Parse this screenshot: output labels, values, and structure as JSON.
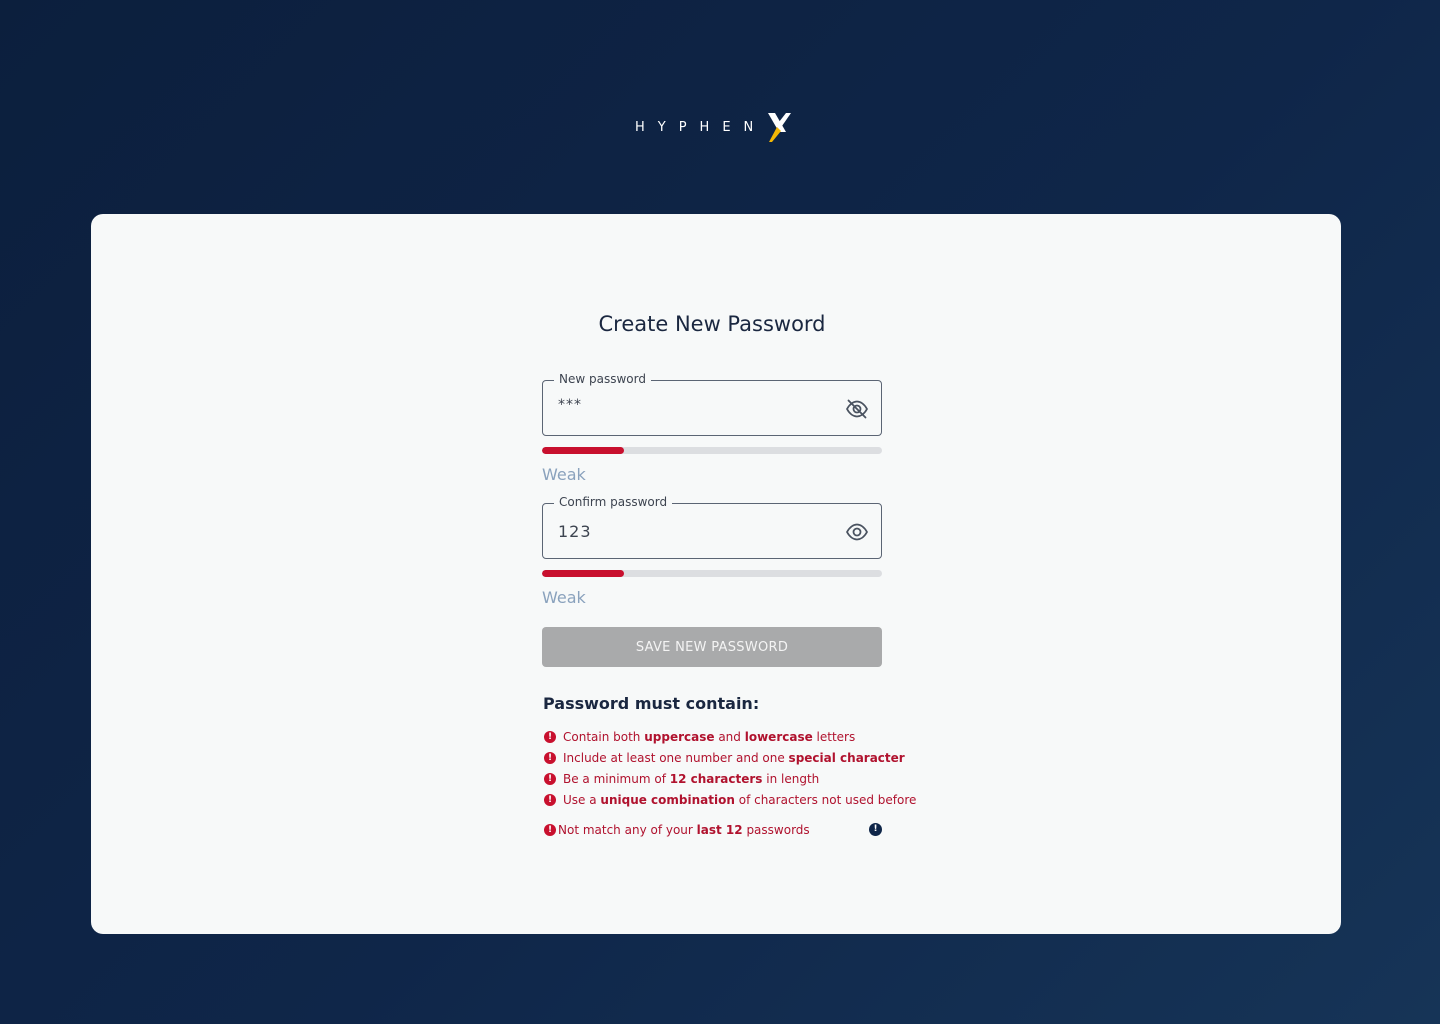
{
  "brand": {
    "logo_text": "HYPHEN",
    "logo_mark": "X",
    "accent_color": "#f2b705"
  },
  "page": {
    "title": "Create New Password"
  },
  "new_password": {
    "label": "New password",
    "value": "***",
    "visibility_icon": "eye-off-icon",
    "strength_fraction": 0.24,
    "strength_label": "Weak"
  },
  "confirm_password": {
    "label": "Confirm password",
    "value": "123",
    "visibility_icon": "eye-icon",
    "strength_fraction": 0.24,
    "strength_label": "Weak"
  },
  "save_button": {
    "label": "SAVE NEW PASSWORD",
    "enabled": false
  },
  "requirements": {
    "title": "Password must contain:",
    "items": [
      {
        "parts": [
          [
            "Contain both ",
            false
          ],
          [
            "uppercase",
            true
          ],
          [
            " and ",
            false
          ],
          [
            "lowercase",
            true
          ],
          [
            " letters",
            false
          ]
        ]
      },
      {
        "parts": [
          [
            "Include at least one number and one ",
            false
          ],
          [
            "special character",
            true
          ]
        ]
      },
      {
        "parts": [
          [
            "Be a minimum of ",
            false
          ],
          [
            "12 characters",
            true
          ],
          [
            " in length",
            false
          ]
        ]
      },
      {
        "parts": [
          [
            "Use a ",
            false
          ],
          [
            "unique combination",
            true
          ],
          [
            " of characters not used before",
            false
          ]
        ]
      }
    ],
    "history": {
      "parts": [
        [
          "Not match any of your ",
          false
        ],
        [
          "last 12",
          true
        ],
        [
          " passwords",
          false
        ]
      ]
    },
    "error_color": "#c8102e",
    "error_icon": "exclamation-circle-icon",
    "info_icon": "info-circle-icon"
  }
}
